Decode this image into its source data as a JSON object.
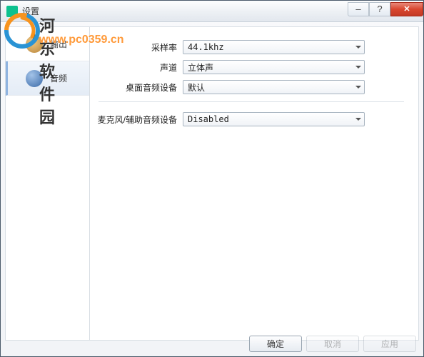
{
  "window": {
    "title": "设置"
  },
  "watermark": {
    "line1": "河东软件园",
    "line2": "www.pc0359.cn"
  },
  "sidebar": {
    "items": [
      {
        "label": "输出",
        "icon": "output-icon"
      },
      {
        "label": "音频",
        "icon": "audio-icon"
      }
    ],
    "active_index": 1
  },
  "form": {
    "sample_rate": {
      "label": "采样率",
      "value": "44.1khz"
    },
    "channels": {
      "label": "声道",
      "value": "立体声"
    },
    "desktop_audio": {
      "label": "桌面音频设备",
      "value": "默认"
    },
    "mic_aux": {
      "label": "麦克风/辅助音频设备",
      "value": "Disabled"
    }
  },
  "buttons": {
    "ok": "确定",
    "cancel": "取消",
    "apply": "应用"
  }
}
